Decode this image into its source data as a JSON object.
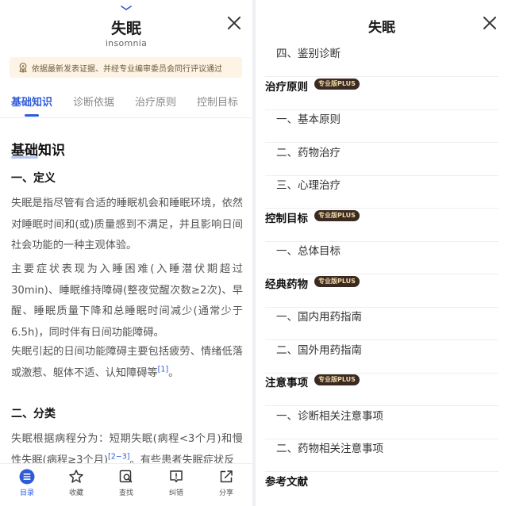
{
  "left": {
    "title": "失眠",
    "subtitle": "insomnia",
    "notice": "依据最新发表证据、并经专业编审委员会同行评议通过",
    "tabs": [
      {
        "label": "基础知识"
      },
      {
        "label": "诊断依据"
      },
      {
        "label": "治疗原则"
      },
      {
        "label": "控制目标"
      }
    ],
    "content": {
      "heading": "基础知识",
      "section1": "一、定义",
      "p1": "失眠是指尽管有合适的睡眠机会和睡眠环境，依然对睡眠时间和(或)质量感到不满足，并且影响日间社会功能的一种主观体验。",
      "p2": "主要症状表现为入睡困难(入睡潜伏期超过30min)、睡眠维持障碍(整夜觉醒次数≥2次)、早醒、睡眠质量下降和总睡眠时间减少(通常少于6.5h)，同时伴有日间功能障碍。",
      "p3": "失眠引起的日间功能障碍主要包括疲劳、情绪低落或激惹、躯体不适、认知障碍等",
      "p3_ref": "[1]",
      "p3_end": "。",
      "section2": "二、分类",
      "p4": "失眠根据病程分为：短期失眠(病程<3个月)和慢性失眠(病程≥3个月)",
      "p4_ref": "[2−3]",
      "p4_end": "。有些患者失眠症状反"
    },
    "bottom_nav": [
      {
        "label": "目录",
        "icon": "menu-icon"
      },
      {
        "label": "收藏",
        "icon": "star-icon"
      },
      {
        "label": "查找",
        "icon": "search-icon"
      },
      {
        "label": "纠错",
        "icon": "report-icon"
      },
      {
        "label": "分享",
        "icon": "share-icon"
      }
    ]
  },
  "right": {
    "title": "失眠",
    "badge": "专业版PLUS",
    "toc": [
      {
        "label": "四、鉴别诊断"
      },
      {
        "label": "治疗原则"
      },
      {
        "label": "一、基本原则"
      },
      {
        "label": "二、药物治疗"
      },
      {
        "label": "三、心理治疗"
      },
      {
        "label": "控制目标"
      },
      {
        "label": "一、总体目标"
      },
      {
        "label": "经典药物"
      },
      {
        "label": "一、国内用药指南"
      },
      {
        "label": "二、国外用药指南"
      },
      {
        "label": "注意事项"
      },
      {
        "label": "一、诊断相关注意事项"
      },
      {
        "label": "二、药物相关注意事项"
      },
      {
        "label": "参考文献"
      }
    ]
  },
  "colors": {
    "accent": "#2f5bd9",
    "notice_bg": "#fdf4e6",
    "badge_bg": "#3a2a22",
    "badge_text": "#f1d9a6"
  }
}
